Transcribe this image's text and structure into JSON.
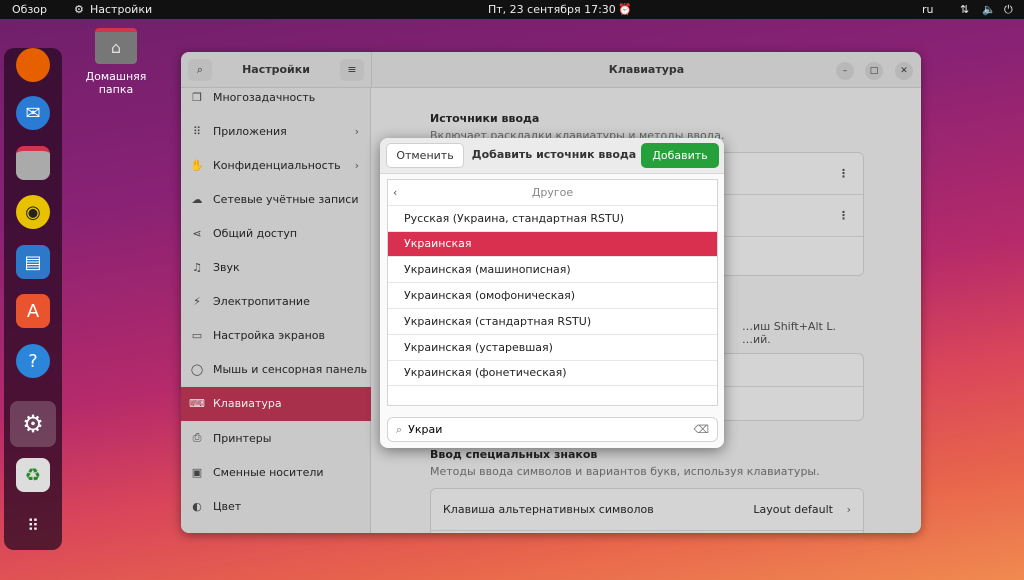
{
  "topbar": {
    "activities": "Обзор",
    "app": "Настройки",
    "clock": "Пт, 23 сентября  17:30",
    "lang": "ru"
  },
  "desktop": {
    "home_folder": "Домашняя папка"
  },
  "window": {
    "sidebar_title": "Настройки",
    "title": "Клавиатура"
  },
  "sidebar": {
    "items": [
      {
        "label": "Многозадачность",
        "icon": "multitasking-icon"
      },
      {
        "label": "Приложения",
        "icon": "apps-icon",
        "chevron": true
      },
      {
        "label": "Конфиденциальность",
        "icon": "privacy-icon",
        "chevron": true
      },
      {
        "label": "Сетевые учётные записи",
        "icon": "cloud-icon"
      },
      {
        "label": "Общий доступ",
        "icon": "share-icon"
      },
      {
        "label": "Звук",
        "icon": "music-icon"
      },
      {
        "label": "Электропитание",
        "icon": "power-icon"
      },
      {
        "label": "Настройка экранов",
        "icon": "display-icon"
      },
      {
        "label": "Мышь и сенсорная панель",
        "icon": "mouse-icon"
      },
      {
        "label": "Клавиатура",
        "icon": "keyboard-icon",
        "selected": true
      },
      {
        "label": "Принтеры",
        "icon": "printer-icon"
      },
      {
        "label": "Сменные носители",
        "icon": "media-icon"
      },
      {
        "label": "Цвет",
        "icon": "color-icon"
      }
    ]
  },
  "main": {
    "input_sources_title": "Источники ввода",
    "input_sources_sub": "Включает раскладки клавиатуры и методы ввода.",
    "switch_hint_1": "…иш Shift+Alt L.",
    "switch_hint_2": "…ий.",
    "special_title": "Ввод специальных знаков",
    "special_sub": "Методы ввода символов и вариантов букв, используя клавиатуры.",
    "alt_key_label": "Клавиша альтернативных символов",
    "alt_key_value": "Layout default"
  },
  "dialog": {
    "cancel": "Отменить",
    "title": "Добавить источник ввода",
    "add": "Добавить",
    "category": "Другое",
    "items": [
      "Русская (Украина, стандартная RSTU)",
      "Украинская",
      "Украинская (машинописная)",
      "Украинская (омофоническая)",
      "Украинская (стандартная RSTU)",
      "Украинская (устаревшая)",
      "Украинская (фонетическая)"
    ],
    "selected_index": 1,
    "search_value": "Украи"
  },
  "colors": {
    "accent": "#d9304f",
    "add_button": "#26a03a"
  }
}
